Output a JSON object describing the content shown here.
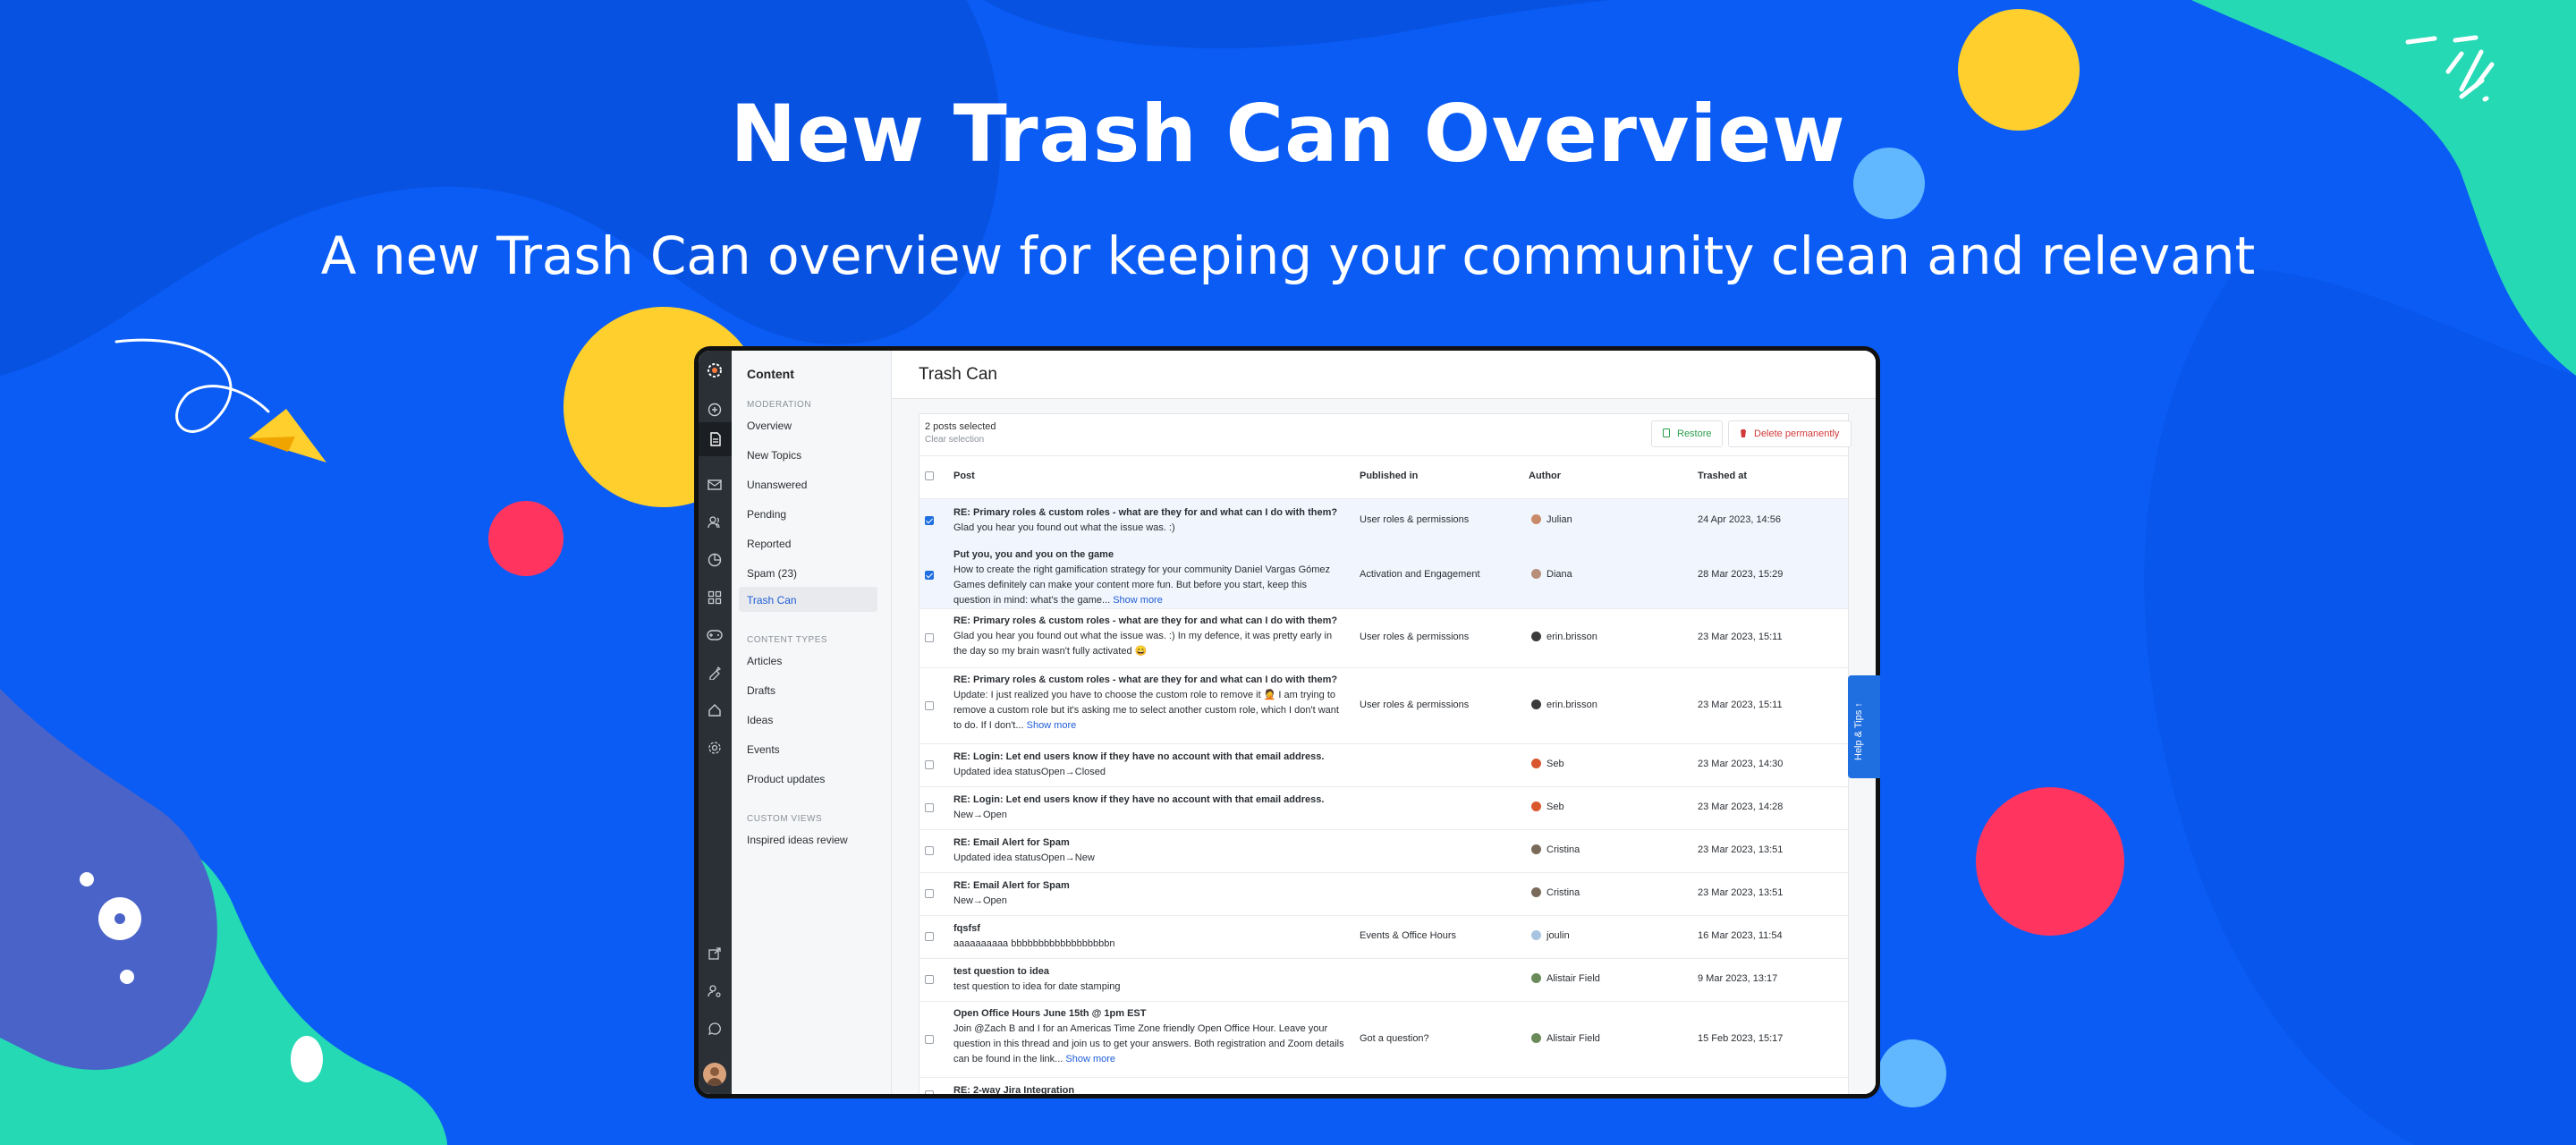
{
  "hero": {
    "title": "New Trash Can Overview",
    "subtitle": "A new Trash Can overview for keeping your community clean and relevant"
  },
  "colors": {
    "background": "#0a5cf5",
    "yellow": "#ffd02d",
    "red": "#ff3560",
    "teal": "#26d9b5",
    "light_blue": "#62b8ff",
    "accent": "#1f6fe0"
  },
  "iconbar": {
    "icons": [
      "logo-icon",
      "plus-icon",
      "document-icon",
      "mail-icon",
      "users-icon",
      "chart-icon",
      "grid-icon",
      "gamepad-icon",
      "brush-icon",
      "home-icon",
      "gear-icon",
      "external-link-icon",
      "user-settings-icon",
      "chat-icon",
      "avatar"
    ]
  },
  "subnav": {
    "title": "Content",
    "moderation_label": "MODERATION",
    "moderation": [
      "Overview",
      "New Topics",
      "Unanswered",
      "Pending",
      "Reported",
      "Spam (23)",
      "Trash Can"
    ],
    "content_types_label": "CONTENT TYPES",
    "content_types": [
      "Articles",
      "Drafts",
      "Ideas",
      "Events",
      "Product updates"
    ],
    "custom_views_label": "CUSTOM VIEWS",
    "custom_views": [
      "Inspired ideas review"
    ]
  },
  "main": {
    "title": "Trash Can",
    "selection_text": "2 posts selected",
    "clear_selection": "Clear selection",
    "restore_label": "Restore",
    "delete_label": "Delete permanently",
    "columns": {
      "post": "Post",
      "published": "Published in",
      "author": "Author",
      "trashed": "Trashed at"
    },
    "rows": [
      {
        "title": "RE: Primary roles & custom roles - what are they for and what can I do with them?",
        "body": "Glad you hear you found out what the issue was. :)",
        "more": "",
        "published": "User roles & permissions",
        "author": "Julian",
        "trashed": "24 Apr 2023, 14:56",
        "checked": true
      },
      {
        "title": "Put you, you and you on the game",
        "body": "How to create the right gamification strategy for your community Daniel Vargas Gómez Games definitely can make your content more fun. But before you start, keep this question in mind: what's the game...",
        "more": "Show more",
        "published": "Activation and Engagement",
        "author": "Diana",
        "trashed": "28 Mar 2023, 15:29",
        "checked": true
      },
      {
        "title": "RE: Primary roles & custom roles - what are they for and what can I do with them?",
        "body": "Glad you hear you found out what the issue was. :) In my defence, it was pretty early in the day so my brain wasn't fully activated 😄",
        "more": "",
        "published": "User roles & permissions",
        "author": "erin.brisson",
        "trashed": "23 Mar 2023, 15:11",
        "checked": false
      },
      {
        "title": "RE: Primary roles & custom roles - what are they for and what can I do with them?",
        "body": "Update: I just realized you have to choose the custom role to remove it 🤦 I am trying to remove a custom role but it's asking me to select another custom role, which I don't want to do. If I don't...",
        "more": "Show more",
        "published": "User roles & permissions",
        "author": "erin.brisson",
        "trashed": "23 Mar 2023, 15:11",
        "checked": false
      },
      {
        "title": "RE: Login: Let end users know if they have no account with that email address.",
        "body": "Updated idea statusOpen→Closed",
        "more": "",
        "published": "",
        "author": "Seb",
        "trashed": "23 Mar 2023, 14:30",
        "checked": false
      },
      {
        "title": "RE: Login: Let end users know if they have no account with that email address.",
        "body": "New→Open",
        "more": "",
        "published": "",
        "author": "Seb",
        "trashed": "23 Mar 2023, 14:28",
        "checked": false
      },
      {
        "title": "RE: Email Alert for Spam",
        "body": "Updated idea statusOpen→New",
        "more": "",
        "published": "",
        "author": "Cristina",
        "trashed": "23 Mar 2023, 13:51",
        "checked": false
      },
      {
        "title": "RE: Email Alert for Spam",
        "body": "New→Open",
        "more": "",
        "published": "",
        "author": "Cristina",
        "trashed": "23 Mar 2023, 13:51",
        "checked": false
      },
      {
        "title": "fqsfsf",
        "body": "aaaaaaaaaa bbbbbbbbbbbbbbbbbbn",
        "more": "",
        "published": "Events & Office Hours",
        "author": "joulin",
        "trashed": "16 Mar 2023, 11:54",
        "checked": false
      },
      {
        "title": "test question to idea",
        "body": "test question to idea for date stamping",
        "more": "",
        "published": "",
        "author": "Alistair Field",
        "trashed": "9 Mar 2023, 13:17",
        "checked": false
      },
      {
        "title": "Open Office Hours June 15th @ 1pm EST",
        "body": "Join @Zach B and I for an Americas Time Zone friendly Open Office Hour. Leave your question in this thread and join us to get your answers. Both registration and Zoom details can be found in the link...",
        "more": "Show more",
        "published": "Got a question?",
        "author": "Alistair Field",
        "trashed": "15 Feb 2023, 15:17",
        "checked": false
      },
      {
        "title": "RE: 2-way Jira Integration",
        "body": "",
        "more": "",
        "published": "",
        "author": "",
        "trashed": "",
        "checked": false
      }
    ]
  },
  "help_tab": "Help & Tips ↑"
}
